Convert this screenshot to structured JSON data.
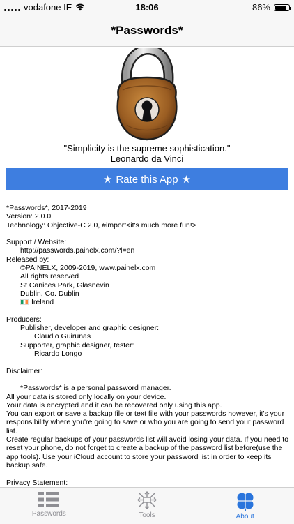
{
  "status_bar": {
    "carrier": "vodafone IE",
    "time": "18:06",
    "battery": "86%",
    "battery_level": 0.86
  },
  "nav": {
    "title": "*Passwords*"
  },
  "quote": {
    "text": "\"Simplicity is the supreme sophistication.\"",
    "author": "Leonardo da Vinci"
  },
  "rate_button": {
    "label": "Rate this App",
    "icon": "star-icon"
  },
  "info": {
    "app_line": "*Passwords*, 2017-2019",
    "version": "Version: 2.0.0",
    "technology": "Technology: Objective-C 2.0, #import<it's much more fun!>",
    "support_heading": "Support / Website:",
    "support_url": "http://passwords.painelx.com/?l=en",
    "released_heading": "Released by:",
    "released_lines": [
      "©PAINELX, 2009-2019, www.painelx.com",
      "All rights reserved",
      "St Canices Park, Glasnevin",
      "Dublin, Co. Dublin",
      "Ireland"
    ],
    "producers_heading": "Producers:",
    "producer_1_role": "Publisher, developer and graphic designer:",
    "producer_1_name": "Claudio Guirunas",
    "producer_2_role": "Supporter, graphic designer, tester:",
    "producer_2_name": "Ricardo Longo",
    "disclaimer_heading": "Disclaimer:",
    "disclaimer_paragraphs": [
      "*Passwords* is a personal password manager.",
      "All your data is stored only locally on your device.",
      "Your data is encrypted and it can be recovered only using this app.",
      "You can export or save a backup file or text file with your passwords however, it's your responsibility where you're going to save or who you are going to send your password list.",
      "Create regular backups of your passwords list will avoid losing your data. If you need to reset your phone, do not forget to create a backup of the password list before(use the app tools). Use your iCloud account to store your password list in order to keep its backup safe."
    ],
    "privacy_heading": "Privacy Statement:"
  },
  "tabs": [
    {
      "label": "Passwords",
      "icon": "list-icon",
      "active": false
    },
    {
      "label": "Tools",
      "icon": "tools-arrows-icon",
      "active": false
    },
    {
      "label": "About",
      "icon": "clover-icon",
      "active": true
    }
  ],
  "colors": {
    "accent": "#3e7ee0",
    "tab_active": "#2a75dc",
    "tab_inactive": "#8e8e93"
  }
}
